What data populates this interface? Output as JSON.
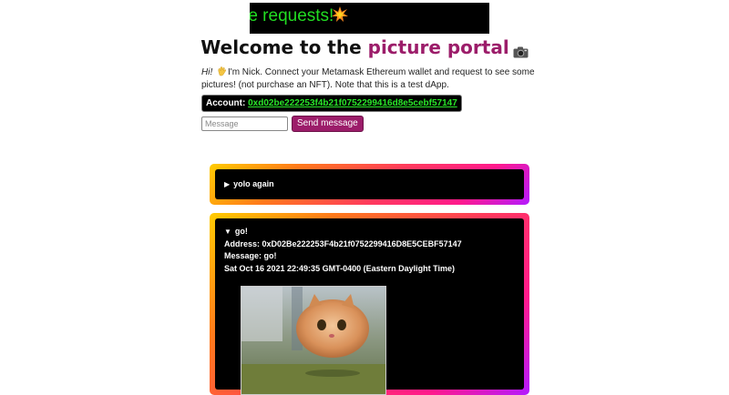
{
  "marquee": {
    "text": "re requests!",
    "icon": "explosion-icon"
  },
  "header": {
    "title_prefix": "Welcome to the ",
    "title_accent": "picture portal",
    "icon": "camera-icon"
  },
  "intro": {
    "hi": "Hi!",
    "text": "I'm Nick. Connect your Metamask Ethereum wallet and request to see some pictures! (not purchase an NFT). Note that this is a test dApp."
  },
  "account": {
    "label": "Account:",
    "address": "0xd02be222253f4b21f0752299416d8e5cebf57147"
  },
  "form": {
    "placeholder": "Message",
    "send_label": "Send message"
  },
  "messages": [
    {
      "summary": "yolo again"
    },
    {
      "summary": "go!",
      "address_line": "Address: 0xD02Be222253F4b21f0752299416D8E5CEBF57147",
      "message_line": "Message: go!",
      "date_line": "Sat Oct 16 2021 22:49:35 GMT-0400 (Eastern Daylight Time)"
    }
  ],
  "colors": {
    "accent": "#9c1d6a",
    "link": "#29e629",
    "marquee_text": "#22dd22"
  }
}
